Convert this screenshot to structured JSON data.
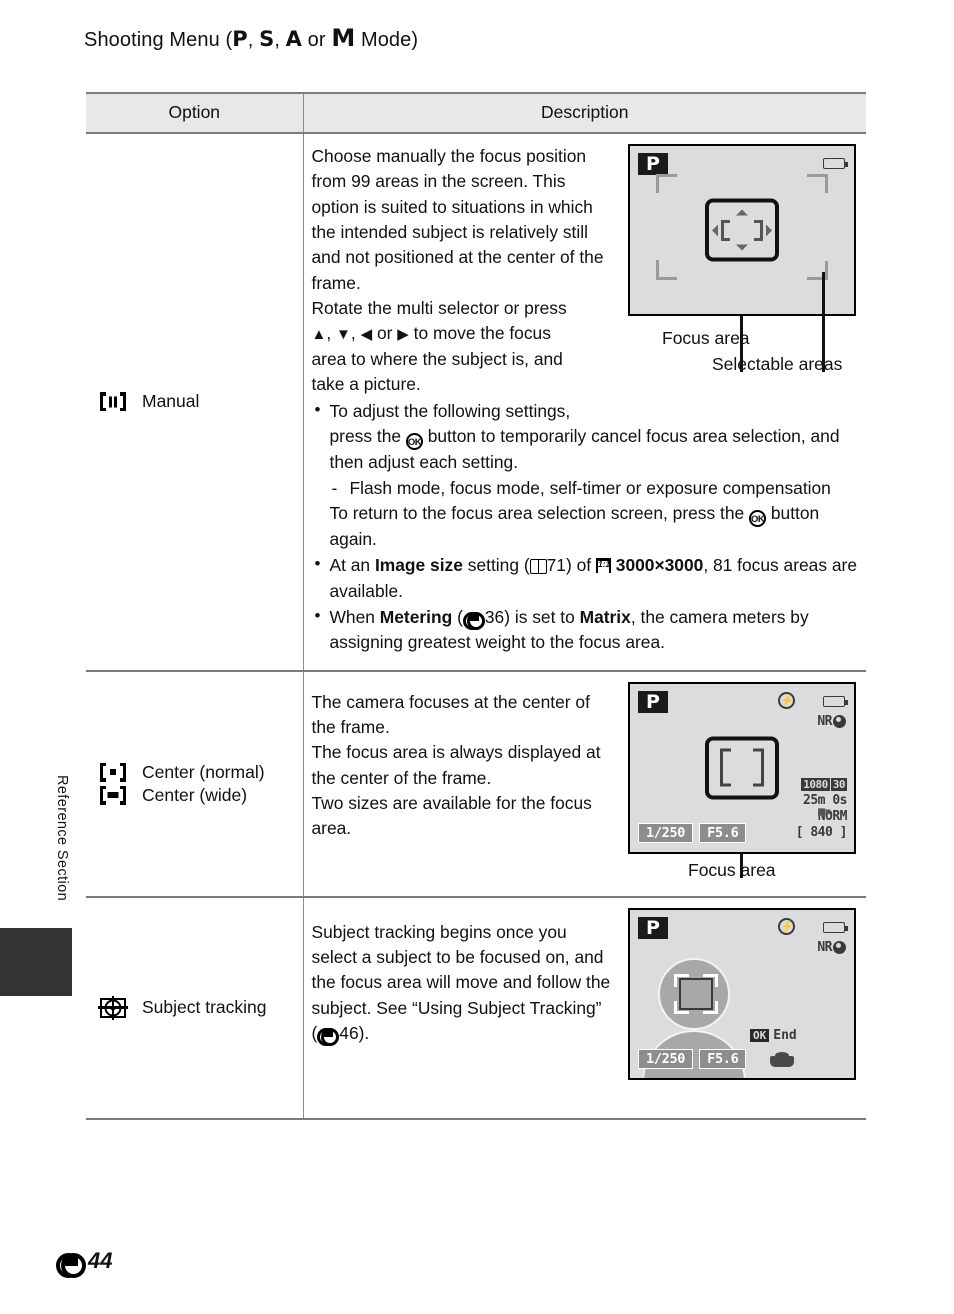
{
  "page": {
    "title_prefix": "Shooting Menu (",
    "modes": [
      "P",
      "S",
      "A",
      "M"
    ],
    "title_sep": ", ",
    "title_or": " or ",
    "title_suffix": " Mode)",
    "side_label": "Reference Section",
    "page_number": "44",
    "page_number_prefix_icon": "e-symbol-icon"
  },
  "table": {
    "headers": {
      "option": "Option",
      "description": "Description"
    },
    "rows": [
      {
        "option_icon": "focus-area-manual-icon",
        "option_label": "Manual",
        "paragraphs": [
          "Choose manually the focus position from 99 areas in the screen. This option is suited to situations in which the intended subject is relatively still and not positioned at the center of the frame.",
          "Rotate the multi selector or press ▲, ▼, ◀ or ▶ to move the focus area to where the subject is, and take a picture."
        ],
        "bullets": [
          {
            "lead": "To adjust the following settings,",
            "line2_a": "press the ",
            "line2_ok": "OK",
            "line2_b": " button to temporarily cancel focus area selection, and then adjust each setting.",
            "sub": "Flash mode, focus mode, self-timer or exposure compensation",
            "tail_a": "To return to the focus area selection screen, press the ",
            "tail_ok": "OK",
            "tail_b": " button again."
          },
          {
            "a": "At an ",
            "b_bold": "Image size",
            "c": " setting (",
            "ref_icon": "book-icon",
            "ref_num": "71",
            "d": ") of ",
            "size_icon": "1:1",
            "e_bold": "3000×3000",
            "f": ", 81 focus areas are available."
          },
          {
            "a": "When ",
            "b_bold": "Metering",
            "c": " (",
            "ref_icon": "e-symbol-icon",
            "ref_num": "36",
            "d": ") is set to ",
            "e_bold": "Matrix",
            "f": ", the camera meters by assigning greatest weight to the focus area."
          }
        ],
        "figure": {
          "mode_badge": "P",
          "icons": [
            "battery-icon"
          ],
          "captions": [
            "Focus area",
            "Selectable areas"
          ]
        }
      },
      {
        "option_icons": [
          "focus-center-normal-icon",
          "focus-center-wide-icon"
        ],
        "option_labels": [
          "Center (normal)",
          "Center (wide)"
        ],
        "paragraphs": [
          "The camera focuses at the center of the frame.",
          "The focus area is always displayed at the center of the frame.",
          "Two sizes are available for the focus area."
        ],
        "figure": {
          "mode_badge": "P",
          "flash_off": "flash-off-icon",
          "battery": "battery-icon",
          "nr_label": "NR",
          "movie_quality": "1080",
          "movie_fps": "30",
          "rec_time": "25m 0s",
          "image_quality": "NORM",
          "shutter_speed": "1/250",
          "aperture": "F5.6",
          "shots_remaining": "[ 840 ]",
          "captions": [
            "Focus area"
          ]
        }
      },
      {
        "option_icon": "subject-tracking-icon",
        "option_label": "Subject tracking",
        "paragraphs_rich": {
          "a": "Subject tracking begins once you select a subject to be focused on, and the focus area will move and follow the subject. See “Using Subject Tracking” (",
          "ref_icon": "e-symbol-icon",
          "ref_num": "46",
          "b": ")."
        },
        "figure": {
          "mode_badge": "P",
          "flash_off": "flash-off-icon",
          "battery": "battery-icon",
          "nr_label": "NR",
          "end_label": "End",
          "ok_label": "OK",
          "shutter_speed": "1/250",
          "aperture": "F5.6"
        }
      }
    ]
  },
  "colors": {
    "rule": "#7b7b7b",
    "header_bg": "#e8e8e8",
    "lcd_bg": "#dcdcdc",
    "tab": "#333333"
  }
}
